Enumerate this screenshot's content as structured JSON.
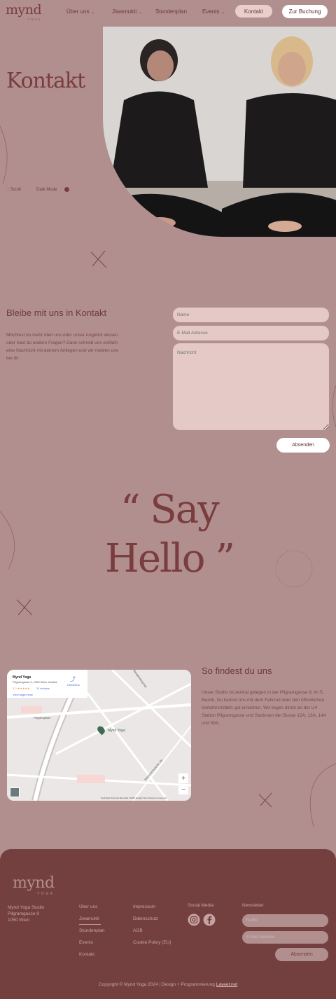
{
  "brand": {
    "logo_word": "mynd",
    "logo_sub": "YOGA"
  },
  "nav": {
    "about": "Über uns",
    "jiwamukti": "Jiwamukti",
    "schedule": "Stundenplan",
    "events": "Events",
    "contact": "Kontakt",
    "booking": "Zur Buchung"
  },
  "hero": {
    "title": "Kontakt",
    "scroll": "Scroll",
    "dark_mode": "Dark Mode"
  },
  "contact": {
    "heading": "Bleibe mit uns in Kontakt",
    "text": "Möchtest du mehr über uns oder unser Angebot wissen oder hast du andere Fragen? Dann schreib uns einfach eine Nachricht mit deinem Anliegen und wir melden uns bei dir.",
    "name_placeholder": "Name",
    "email_placeholder": "E-Mail Adresse",
    "message_placeholder": "Nachricht",
    "submit": "Absenden"
  },
  "say_hello": {
    "line1": "“ Say",
    "line2": "Hello ”"
  },
  "location": {
    "heading": "So findest du uns",
    "text": "Unser Studio ist zentral gelegen in der Pilgramgasse 9, im 5. Bezirk. Du kannst uns mit dem Fahrrad oder den öffentlichen Verkehrsmitteln gut erreichen. Wir liegen direkt an der U4 Station Pilgramgasse und Stationen der Busse 12A, 13A, 14A und 59A.",
    "map": {
      "place_name": "Mynd Yoga",
      "address": "Pilgramgasse 9, 1050 Wien, Austria",
      "rating": "5.0 ★★★★★",
      "reviews": "11 reviews",
      "larger_map": "View larger map",
      "directions": "Directions",
      "pin_label": "Mynd Yoga",
      "labels": [
        "Pilgramgasse",
        "Margaretengürtel",
        "Reinprechtsdorfer Str."
      ],
      "attribution": "Keyboard shortcuts   Map data ©2024 Google   Terms   Report a map error"
    }
  },
  "footer": {
    "logo_word": "mynd",
    "logo_sub": "YOGA",
    "address": [
      "Mynd Yoga Studio",
      "Pilgramgasse 9",
      "1050 Wien"
    ],
    "col1": [
      "Über uns",
      "Jiwamukti",
      "Stundenplan",
      "Events",
      "Kontakt"
    ],
    "col2": [
      "Impressum",
      "Datenschutz",
      "AGB",
      "Cookie Policy (EU)"
    ],
    "social_heading": "Social Media",
    "newsletter_heading": "Newsletter",
    "nl_name": "Name",
    "nl_email": "E-Mail Adresse",
    "nl_submit": "Absenden",
    "copyright_prefix": "Copyright © Mynd Yoga 2024 | Design + Programmierung",
    "copyright_link": "Layeet.net"
  },
  "colors": {
    "background": "#b18f8f",
    "accent": "#7a3d3d",
    "footer": "#74403f",
    "field": "#e4c9c6"
  }
}
